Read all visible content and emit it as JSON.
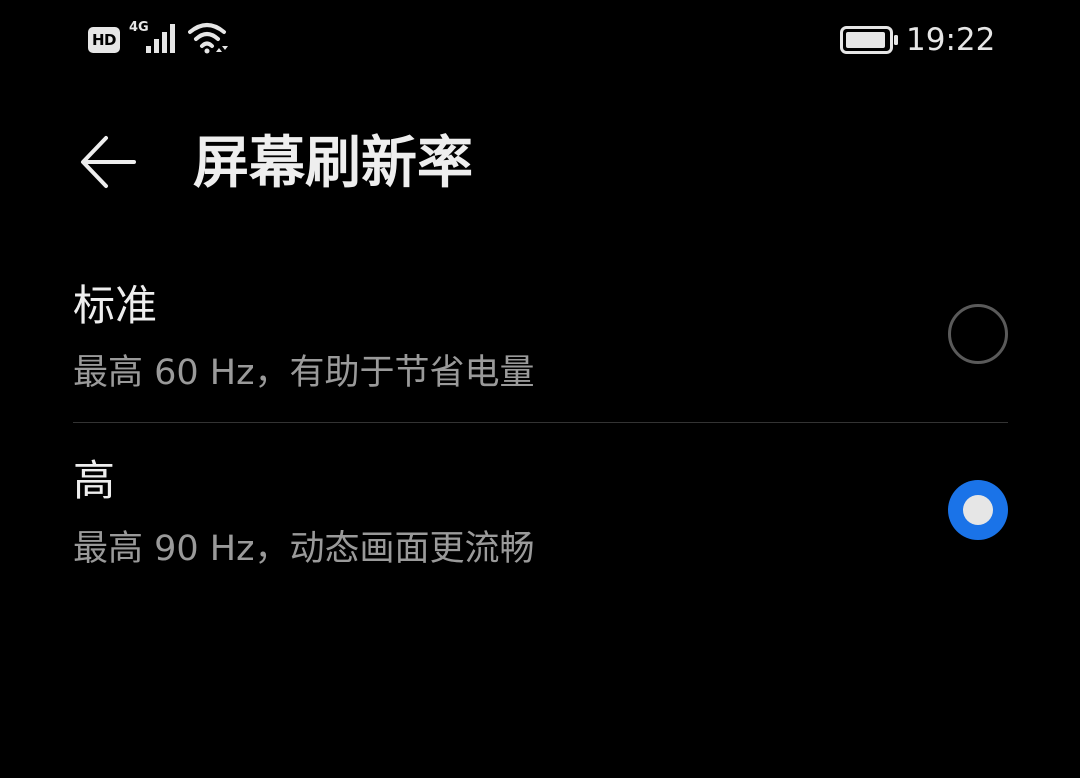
{
  "status_bar": {
    "hd_label": "HD",
    "network_label": "4G",
    "time": "19:22",
    "icons": [
      "hd-icon",
      "signal-icon",
      "wifi-icon",
      "battery-icon"
    ]
  },
  "header": {
    "back_icon": "arrow-left-icon",
    "title": "屏幕刷新率"
  },
  "options": [
    {
      "title": "标准",
      "subtitle": "最高 60 Hz，有助于节省电量",
      "selected": false
    },
    {
      "title": "高",
      "subtitle": "最高 90 Hz，动态画面更流畅",
      "selected": true
    }
  ],
  "colors": {
    "background": "#000000",
    "text_primary": "#eeeeee",
    "text_secondary": "#9a9a9a",
    "accent": "#1a73e8",
    "divider": "#333333"
  }
}
